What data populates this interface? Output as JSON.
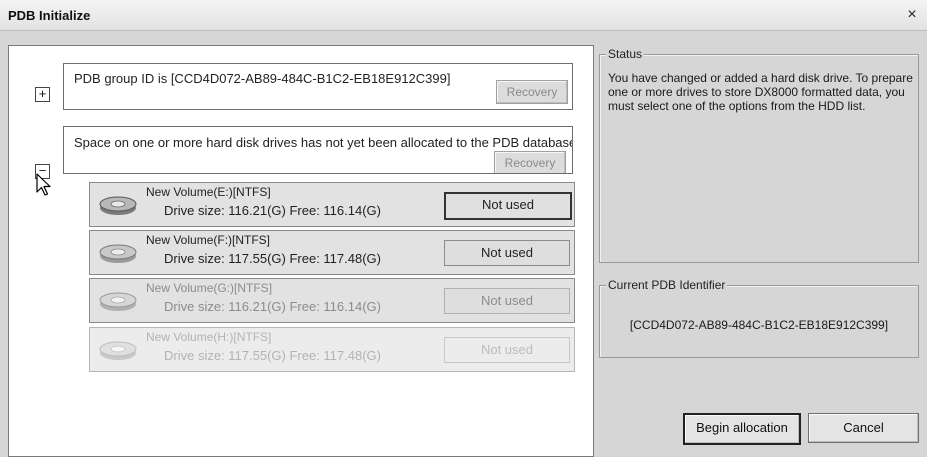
{
  "window": {
    "title": "PDB Initialize",
    "close_glyph": "×"
  },
  "groups": [
    {
      "expander": "+",
      "message": "PDB group ID is [CCD4D072-AB89-484C-B1C2-EB18E912C399]",
      "recovery_label": "Recovery"
    },
    {
      "expander": "−",
      "message": "Space on one or more hard disk drives has not yet been allocated to the PDB database",
      "recovery_label": "Recovery"
    }
  ],
  "drives": [
    {
      "name": "New Volume(E:)[NTFS]",
      "size": "Drive size: 116.21(G) Free: 116.14(G)",
      "button": "Not used",
      "state": "active"
    },
    {
      "name": "New Volume(F:)[NTFS]",
      "size": "Drive size: 117.55(G) Free: 117.48(G)",
      "button": "Not used",
      "state": "normal"
    },
    {
      "name": "New Volume(G:)[NTFS]",
      "size": "Drive size: 116.21(G) Free: 116.14(G)",
      "button": "Not used",
      "state": "dim"
    },
    {
      "name": "New Volume(H:)[NTFS]",
      "size": "Drive size: 117.55(G) Free: 117.48(G)",
      "button": "Not used",
      "state": "disabled"
    }
  ],
  "status": {
    "legend": "Status",
    "text": "You have changed or added a hard disk drive. To prepare one or more drives to store DX8000 formatted data, you must select one of the options from the HDD list."
  },
  "identifier": {
    "legend": "Current PDB Identifier",
    "value": "[CCD4D072-AB89-484C-B1C2-EB18E912C399]"
  },
  "buttons": {
    "begin": "Begin allocation",
    "cancel": "Cancel"
  },
  "icons": {
    "drive": "hard-drive-icon",
    "cursor": "mouse-pointer-icon",
    "close": "close-icon"
  }
}
